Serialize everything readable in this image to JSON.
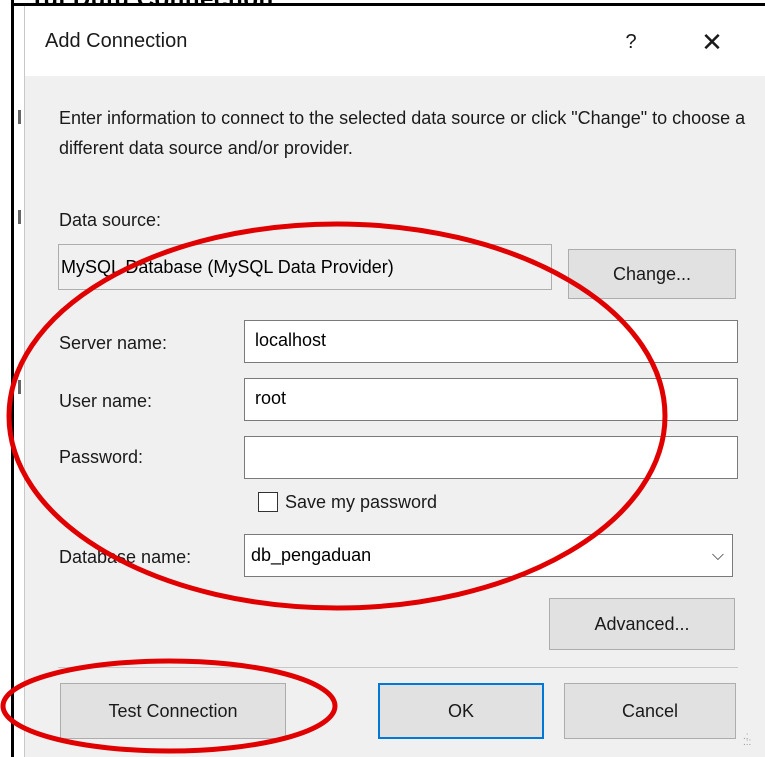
{
  "dialog": {
    "title": "Add Connection",
    "help_glyph": "?",
    "close_glyph": "✕",
    "intro": "Enter information to connect to the selected data source or click \"Change\" to choose a different data source and/or provider."
  },
  "datasource": {
    "label": "Data source:",
    "value": "MySQL Database (MySQL Data Provider)",
    "change_label": "Change..."
  },
  "server": {
    "label": "Server name:",
    "value": "localhost"
  },
  "user": {
    "label": "User name:",
    "value": "root"
  },
  "password": {
    "label": "Password:",
    "value": ""
  },
  "save_password": {
    "label": "Save my password",
    "checked": false
  },
  "database": {
    "label": "Database name:",
    "value": "db_pengaduan",
    "chevron": "⌵"
  },
  "buttons": {
    "advanced": "Advanced...",
    "test": "Test Connection",
    "ok": "OK",
    "cancel": "Cancel"
  },
  "background": {
    "partial_title": "Tui Dutu Connection"
  },
  "colors": {
    "annotation": "#e00000",
    "ok_border": "#0078d7"
  }
}
